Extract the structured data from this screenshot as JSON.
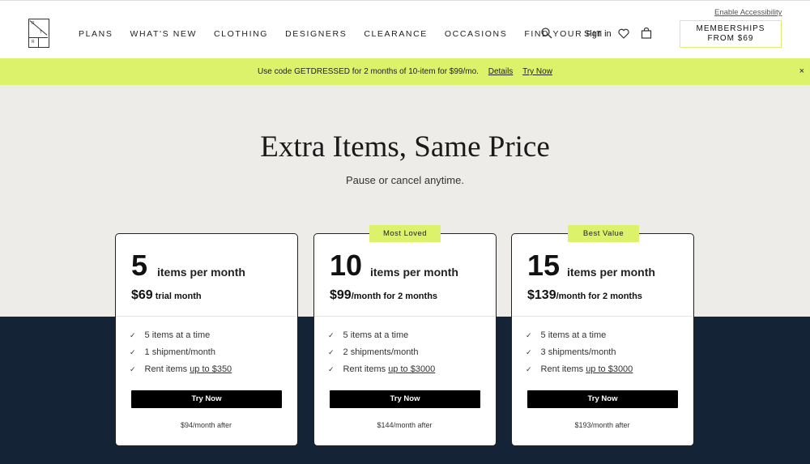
{
  "header": {
    "logo_chars": [
      "R",
      "T",
      "R"
    ],
    "nav": [
      "PLANS",
      "WHAT'S NEW",
      "CLOTHING",
      "DESIGNERS",
      "CLEARANCE",
      "OCCASIONS",
      "FIND YOUR FIT"
    ],
    "signin": "Sign in",
    "enable_accessibility": "Enable Accessibility",
    "memberships_line1": "MEMBERSHIPS",
    "memberships_line2": "FROM $69",
    "icons": [
      "search-icon",
      "heart-icon",
      "bag-icon"
    ]
  },
  "promo": {
    "text": "Use code GETDRESSED for 2 months of 10-item for $99/mo.",
    "details": "Details",
    "try_now": "Try Now",
    "close": "×"
  },
  "hero": {
    "title": "Extra Items, Same Price",
    "subtitle": "Pause or cancel anytime."
  },
  "plans": [
    {
      "badge": "",
      "count": "5",
      "count_label": "items per month",
      "price": "$69",
      "price_note": " trial month",
      "features": [
        "5 items at a time",
        "1 shipment/month"
      ],
      "rent_prefix": "Rent items ",
      "rent_link": "up to $350",
      "button": "Try Now",
      "after": "$94/month after"
    },
    {
      "badge": "Most Loved",
      "count": "10",
      "count_label": "items per month",
      "price": "$99",
      "price_note": "/month for 2 months",
      "features": [
        "5 items at a time",
        "2 shipments/month"
      ],
      "rent_prefix": "Rent items ",
      "rent_link": "up to $3000",
      "button": "Try Now",
      "after": "$144/month after"
    },
    {
      "badge": "Best Value",
      "count": "15",
      "count_label": "items per month",
      "price": "$139",
      "price_note": "/month for 2 months",
      "features": [
        "5 items at a time",
        "3 shipments/month"
      ],
      "rent_prefix": "Rent items ",
      "rent_link": "up to $3000",
      "button": "Try Now",
      "after": "$193/month after"
    }
  ],
  "colors": {
    "accent": "#dbf26a",
    "hero_bg": "#eeece8",
    "dark_bg": "#152336"
  }
}
